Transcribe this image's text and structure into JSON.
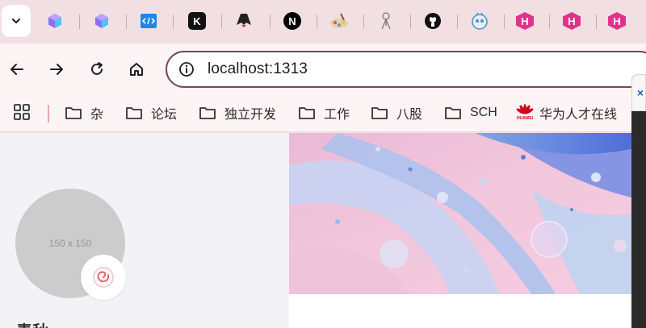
{
  "browser": {
    "tabs": [
      {
        "icon": "gradient-cube-icon",
        "color": "#7a5cff"
      },
      {
        "icon": "gradient-cube-icon",
        "color": "#7a5cff"
      },
      {
        "icon": "code-window-icon",
        "color": "#1e88e5"
      },
      {
        "icon": "k-logo-icon",
        "color": "#111111",
        "letter": "K"
      },
      {
        "icon": "astro-logo-icon",
        "color": "#222222"
      },
      {
        "icon": "nextjs-logo-icon",
        "color": "#000000",
        "letter": "N"
      },
      {
        "icon": "painting-icon",
        "color": "#c9a27a"
      },
      {
        "icon": "anime-figure-icon",
        "color": "#999999"
      },
      {
        "icon": "github-icon",
        "color": "#111111"
      },
      {
        "icon": "robot-face-icon",
        "color": "#4a90c2"
      },
      {
        "icon": "hexo-logo-icon",
        "color": "#e0328a",
        "letter": "H"
      },
      {
        "icon": "hexo-logo-icon",
        "color": "#e0328a",
        "letter": "H"
      },
      {
        "icon": "hexo-logo-icon",
        "color": "#e0328a",
        "letter": "H"
      }
    ]
  },
  "toolbar": {
    "url": "localhost:1313"
  },
  "bookmarks": [
    {
      "label": "杂",
      "icon": "folder-icon"
    },
    {
      "label": "论坛",
      "icon": "folder-icon"
    },
    {
      "label": "独立开发",
      "icon": "folder-icon"
    },
    {
      "label": "工作",
      "icon": "folder-icon"
    },
    {
      "label": "八股",
      "icon": "folder-icon"
    },
    {
      "label": "SCH",
      "icon": "folder-icon"
    },
    {
      "label": "华为人才在线",
      "icon": "huawei-logo-icon",
      "logo_text": "HUAWEI"
    }
  ],
  "page": {
    "avatar_placeholder": "150 x 150",
    "author_name": "青秋"
  },
  "colors": {
    "accent": "#7d4452",
    "tabstrip": "#f2dfe2",
    "toolbar": "#fcf4f5"
  }
}
